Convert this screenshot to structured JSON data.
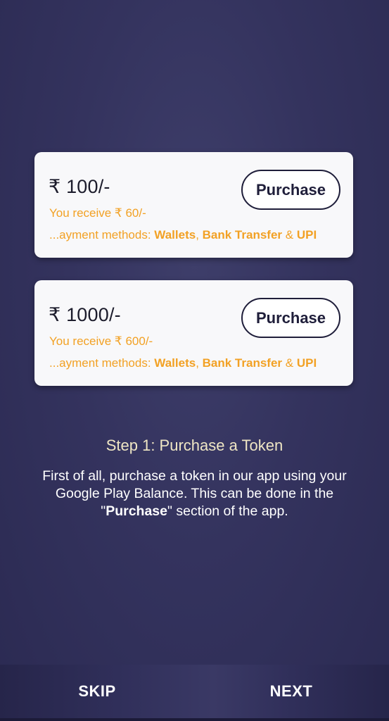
{
  "plans": [
    {
      "price": "₹ 100/-",
      "receive": "You receive ₹ 60/-",
      "methods_prefix": "...ayment methods: ",
      "method_1": "Wallets",
      "sep_1": ", ",
      "method_2": "Bank Transfer",
      "sep_2": " & ",
      "method_3": "UPI",
      "button_label": "Purchase"
    },
    {
      "price": "₹ 1000/-",
      "receive": "You receive ₹ 600/-",
      "methods_prefix": "...ayment methods: ",
      "method_1": "Wallets",
      "sep_1": ", ",
      "method_2": "Bank Transfer",
      "sep_2": " & ",
      "method_3": "UPI",
      "button_label": "Purchase"
    }
  ],
  "step": {
    "title": "Step 1: Purchase a Token",
    "desc_before": "First of all, purchase a token in our app using your Google Play Balance. This can be done in the \"",
    "desc_bold": "Purchase",
    "desc_after": "\" section of the app."
  },
  "nav": {
    "skip_label": "SKIP",
    "next_label": "NEXT"
  },
  "colors": {
    "accent_orange": "#f2a124",
    "background": "#34335e",
    "card": "#f8f8fa",
    "button_border": "#1f1e3a",
    "step_title": "#efe6c4"
  }
}
